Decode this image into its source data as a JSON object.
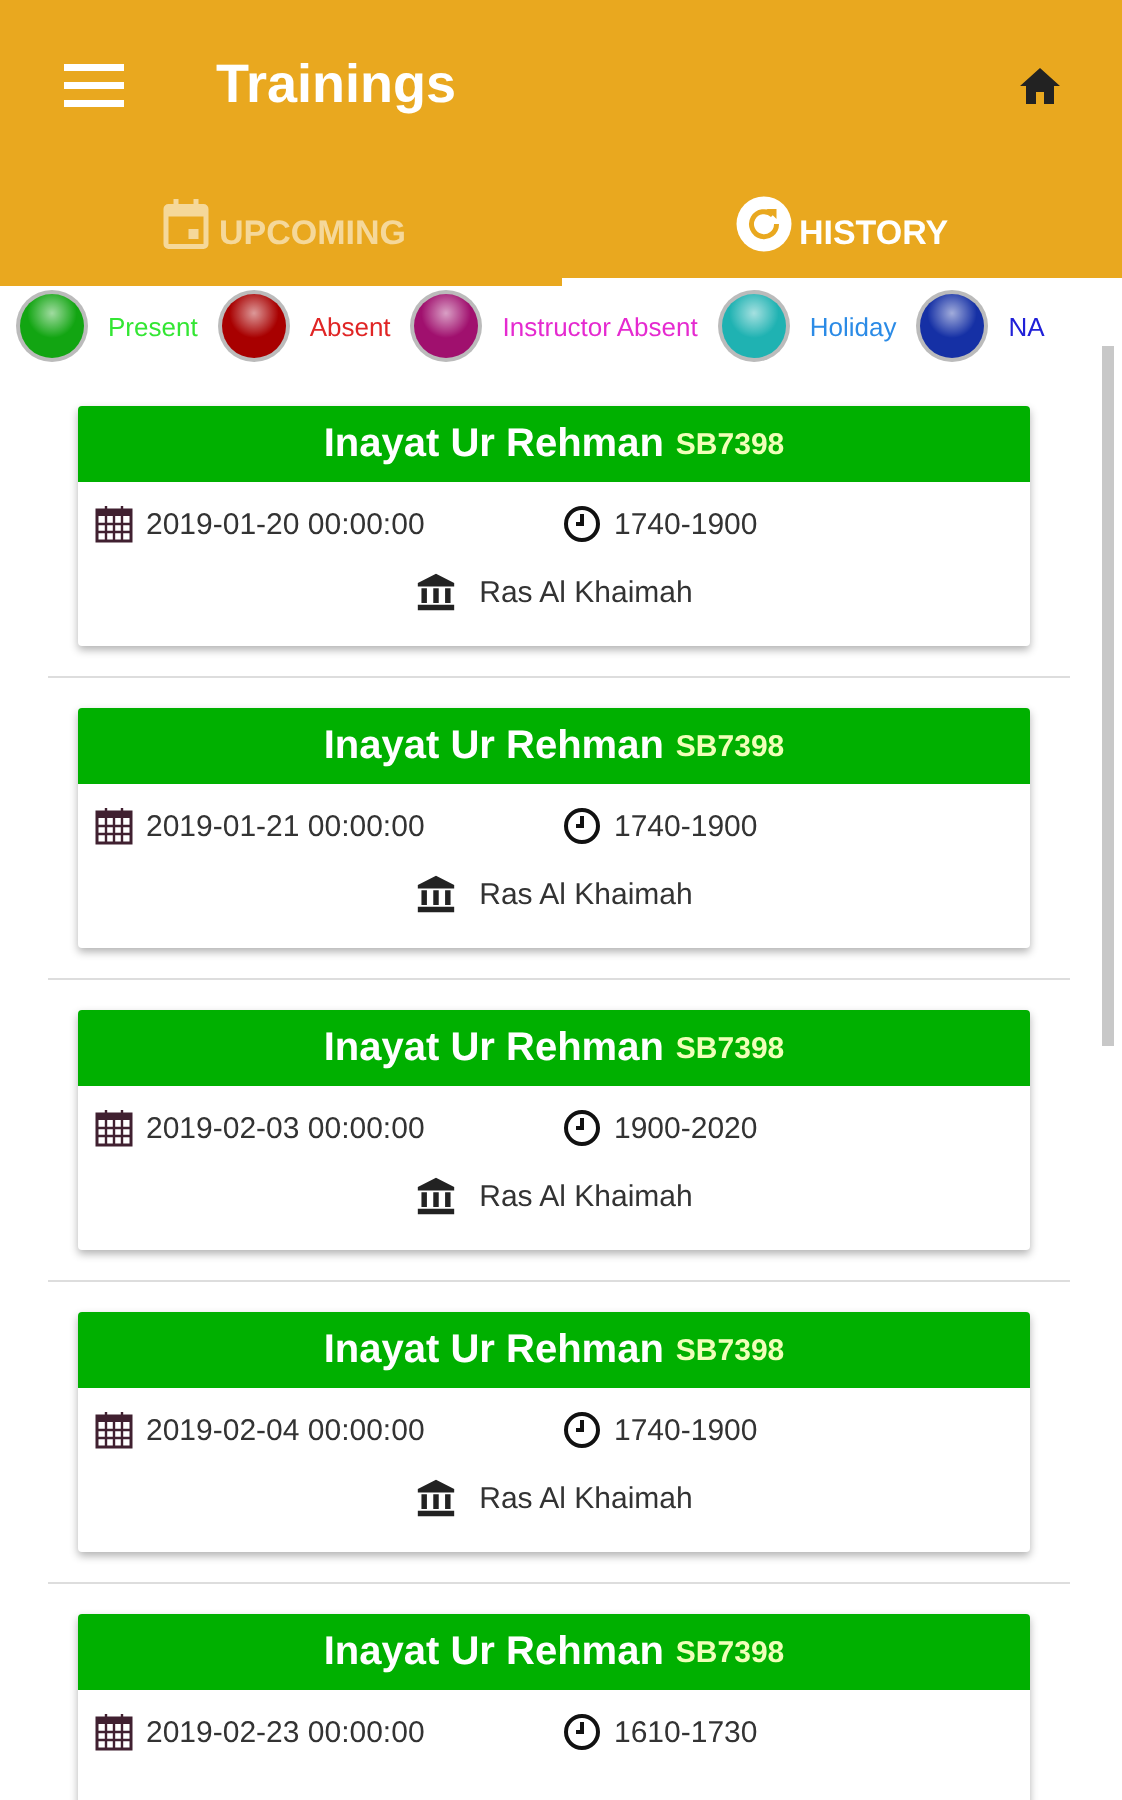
{
  "app_bar": {
    "title": "Trainings"
  },
  "tabs": [
    {
      "label": "UPCOMING",
      "selected": false
    },
    {
      "label": "HISTORY",
      "selected": true
    }
  ],
  "legend": [
    {
      "label": "Present",
      "color": "#12a512"
    },
    {
      "label": "Absent",
      "color": "#a80000"
    },
    {
      "label": "Instructor Absent",
      "color": "#a0106e"
    },
    {
      "label": "Holiday",
      "color": "#1fb2b2"
    },
    {
      "label": "NA",
      "color": "#1530a5"
    }
  ],
  "trainings": [
    {
      "name": "Inayat Ur Rehman",
      "code": "SB7398",
      "color": "#00b000",
      "date": "2019-01-20 00:00:00",
      "time": "1740-1900",
      "location": "Ras Al Khaimah"
    },
    {
      "name": "Inayat Ur Rehman",
      "code": "SB7398",
      "color": "#00b000",
      "date": "2019-01-21 00:00:00",
      "time": "1740-1900",
      "location": "Ras Al Khaimah"
    },
    {
      "name": "Inayat Ur Rehman",
      "code": "SB7398",
      "color": "#00b000",
      "date": "2019-02-03 00:00:00",
      "time": "1900-2020",
      "location": "Ras Al Khaimah"
    },
    {
      "name": "Inayat Ur Rehman",
      "code": "SB7398",
      "color": "#00b000",
      "date": "2019-02-04 00:00:00",
      "time": "1740-1900",
      "location": "Ras Al Khaimah"
    },
    {
      "name": "Inayat Ur Rehman",
      "code": "SB7398",
      "color": "#00b000",
      "date": "2019-02-23 00:00:00",
      "time": "1610-1730"
    }
  ]
}
